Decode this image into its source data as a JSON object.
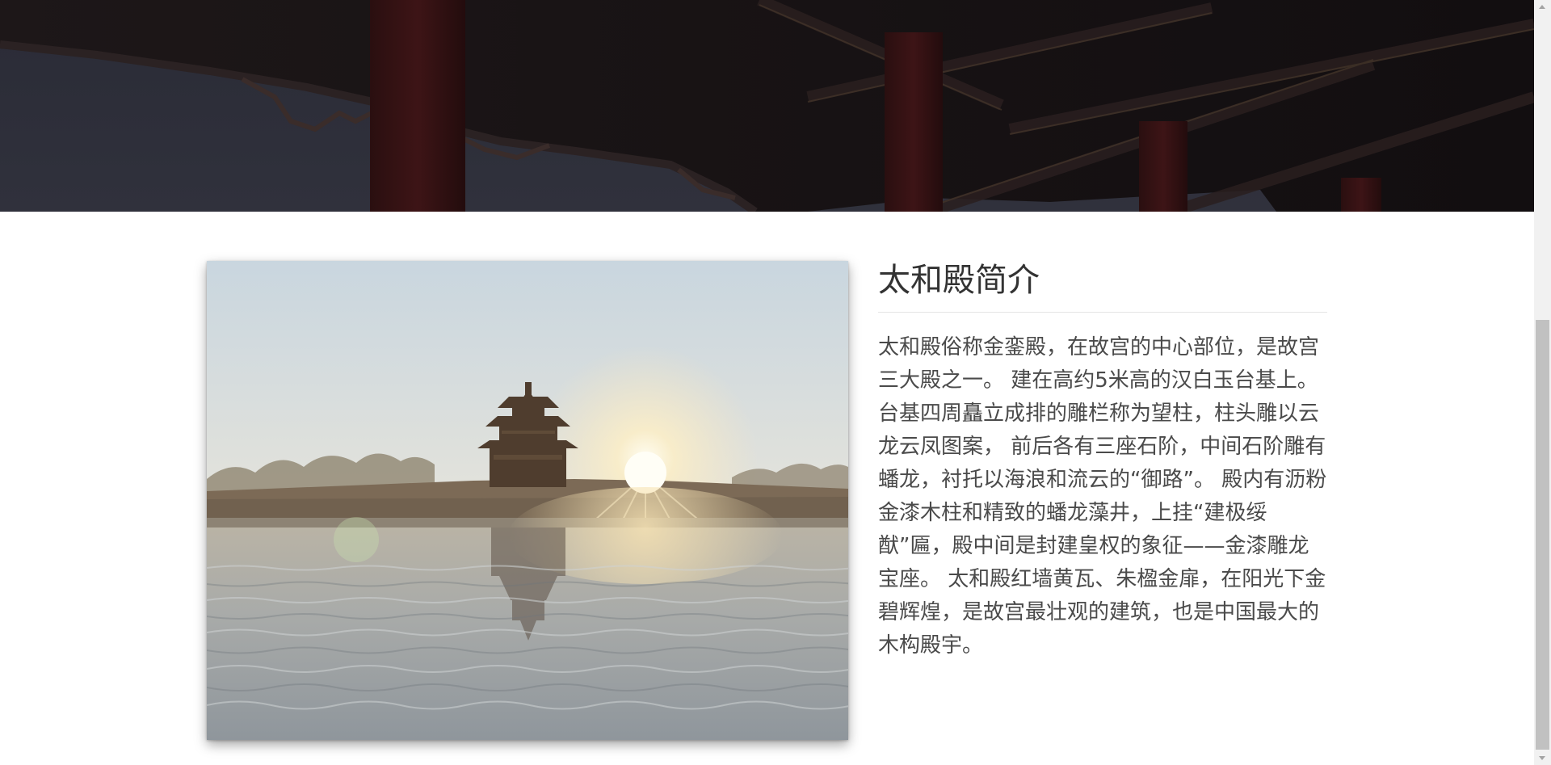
{
  "hero": {
    "image_description_name": "forbidden-city-pavilion-eaves-photo"
  },
  "article": {
    "title": "太和殿简介",
    "body": "太和殿俗称金銮殿，在故宫的中心部位，是故宫三大殿之一。 建在高约5米高的汉白玉台基上。台基四周矗立成排的雕栏称为望柱，柱头雕以云龙云凤图案， 前后各有三座石阶，中间石阶雕有蟠龙，衬托以海浪和流云的“御路”。 殿内有沥粉金漆木柱和精致的蟠龙藻井，上挂“建极绥猷”匾，殿中间是封建皇权的象征——金漆雕龙宝座。 太和殿红墙黄瓦、朱楹金扉，在阳光下金碧辉煌，是故宫最壮观的建筑，也是中国最大的木构殿宇。"
  },
  "colors": {
    "title": "#333333",
    "body": "#4a4a4a",
    "divider": "#e5e5e5",
    "scrollbar_track": "#f1f1f1",
    "scrollbar_thumb": "#c1c1c1"
  }
}
